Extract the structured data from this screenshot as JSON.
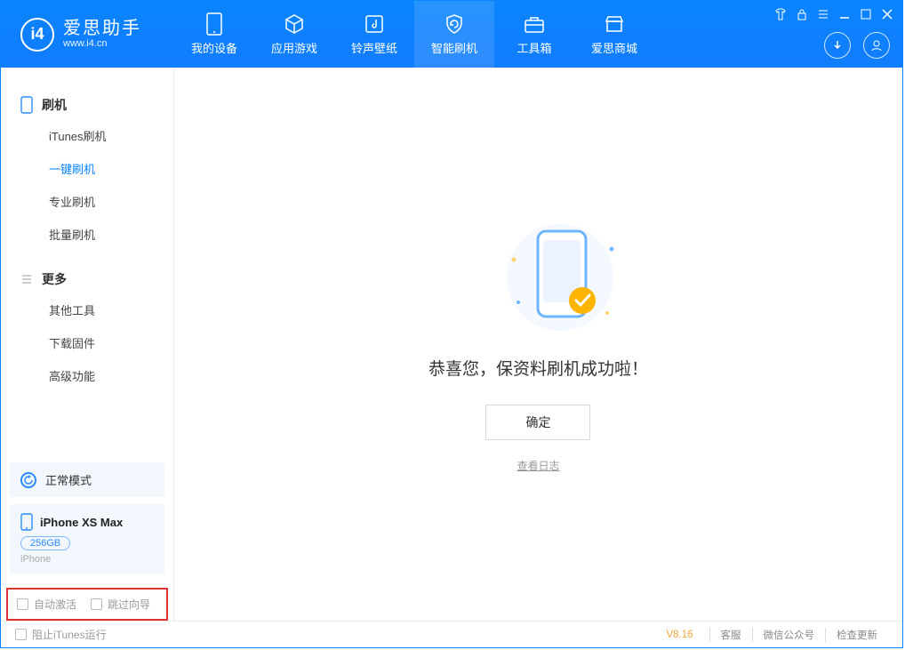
{
  "header": {
    "app_name": "爱思助手",
    "app_url": "www.i4.cn",
    "tabs": [
      {
        "label": "我的设备"
      },
      {
        "label": "应用游戏"
      },
      {
        "label": "铃声壁纸"
      },
      {
        "label": "智能刷机"
      },
      {
        "label": "工具箱"
      },
      {
        "label": "爱思商城"
      }
    ]
  },
  "sidebar": {
    "sections": [
      {
        "title": "刷机",
        "items": [
          "iTunes刷机",
          "一键刷机",
          "专业刷机",
          "批量刷机"
        ]
      },
      {
        "title": "更多",
        "items": [
          "其他工具",
          "下载固件",
          "高级功能"
        ]
      }
    ],
    "mode_label": "正常模式",
    "device": {
      "name": "iPhone XS Max",
      "storage": "256GB",
      "type": "iPhone"
    },
    "options": [
      "自动激活",
      "跳过向导"
    ]
  },
  "main": {
    "success_message": "恭喜您，保资料刷机成功啦！",
    "confirm_label": "确定",
    "log_link": "查看日志"
  },
  "footer": {
    "block_itunes": "阻止iTunes运行",
    "version": "V8.16",
    "links": [
      "客服",
      "微信公众号",
      "检查更新"
    ]
  },
  "colors": {
    "primary": "#0a84ff",
    "accent": "#ffb400",
    "highlight_border": "#d33"
  }
}
